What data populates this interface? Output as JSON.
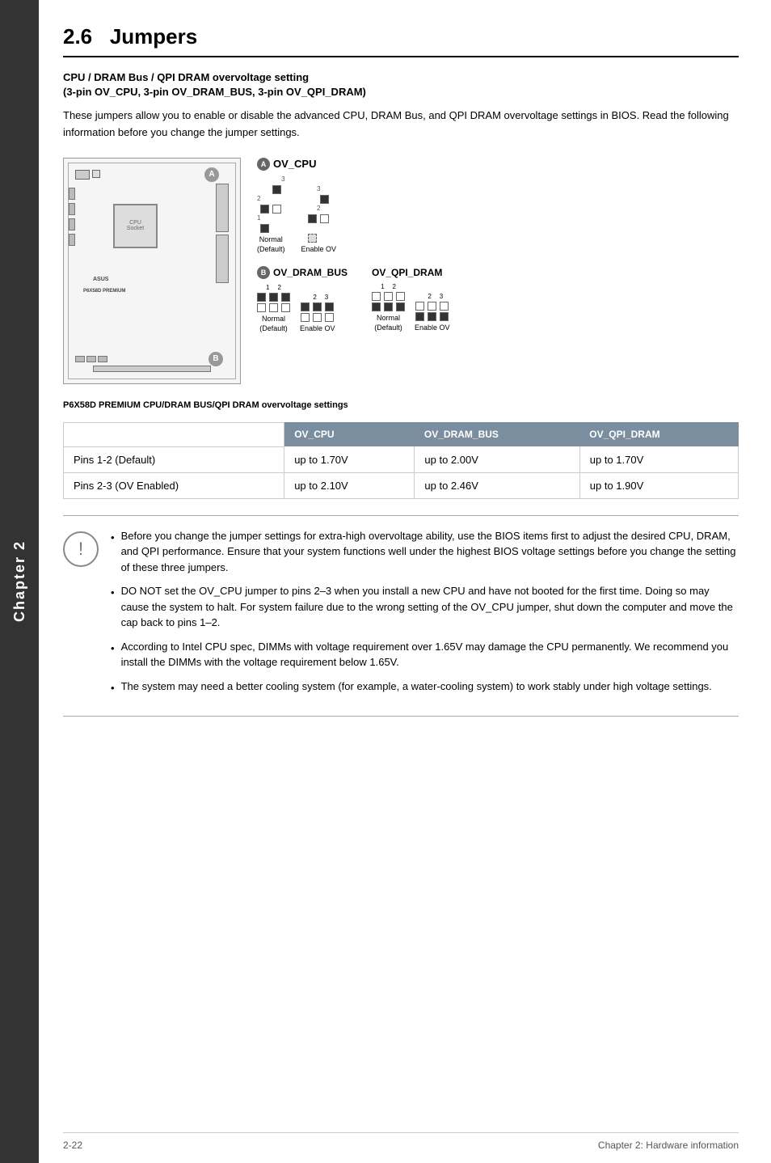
{
  "sidebar": {
    "label": "Chapter 2"
  },
  "section": {
    "number": "2.6",
    "title": "Jumpers"
  },
  "subsection": {
    "title": "CPU / DRAM Bus / QPI DRAM overvoltage setting",
    "subtitle": "(3-pin OV_CPU, 3-pin OV_DRAM_BUS, 3-pin OV_QPI_DRAM)"
  },
  "description": "These jumpers allow you to enable or disable the advanced CPU, DRAM Bus, and QPI DRAM overvoltage settings in BIOS. Read the following information before you change the jumper settings.",
  "diagram": {
    "caption": "P6X58D PREMIUM CPU/DRAM BUS/QPI DRAM overvoltage settings",
    "labels": {
      "a": "A",
      "b": "B",
      "ov_cpu": "OV_CPU",
      "ov_dram_bus": "OV_DRAM_BUS",
      "ov_qpi_dram": "OV_QPI_DRAM",
      "normal_default": "Normal\n(Default)",
      "enable_ov": "Enable OV"
    }
  },
  "table": {
    "headers": [
      "",
      "OV_CPU",
      "OV_DRAM_BUS",
      "OV_QPI_DRAM"
    ],
    "rows": [
      {
        "label": "Pins 1-2 (Default)",
        "ov_cpu": "up to 1.70V",
        "ov_dram_bus": "up to 2.00V",
        "ov_qpi_dram": "up to 1.70V"
      },
      {
        "label": "Pins 2-3 (OV Enabled)",
        "ov_cpu": "up to 2.10V",
        "ov_dram_bus": "up to 2.46V",
        "ov_qpi_dram": "up to 1.90V"
      }
    ]
  },
  "warnings": [
    "Before you change the jumper settings for extra-high overvoltage ability, use the BIOS items first to adjust the desired CPU, DRAM, and QPI performance. Ensure that your system functions well under the highest BIOS voltage settings before you change the setting of these three jumpers.",
    "DO NOT set the OV_CPU jumper to pins 2–3 when you install a new CPU and have not booted for the first time. Doing so may cause the system to halt. For system failure due to the wrong setting of the OV_CPU jumper, shut down the computer and move the cap back to pins 1–2.",
    "According to Intel CPU spec, DIMMs with voltage requirement over 1.65V may damage the CPU permanently. We recommend you install the DIMMs with the voltage requirement below 1.65V.",
    "The system may need a better cooling system (for example, a water-cooling system) to work stably under high voltage settings."
  ],
  "footer": {
    "left": "2-22",
    "right": "Chapter 2: Hardware information"
  }
}
